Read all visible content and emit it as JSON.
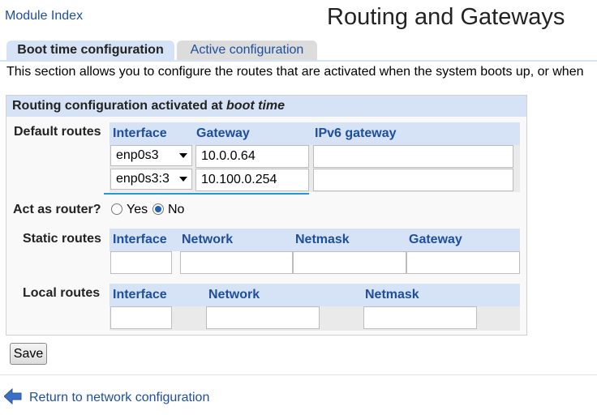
{
  "header": {
    "module_index": "Module Index",
    "title": "Routing and Gateways"
  },
  "tabs": [
    {
      "label": "Boot time configuration",
      "active": true
    },
    {
      "label": "Active configuration",
      "active": false
    }
  ],
  "intro": "This section allows you to configure the routes that are activated when the system boots up, or when",
  "panel": {
    "title_prefix": "Routing configuration activated at ",
    "title_emphasis": "boot time",
    "default_routes": {
      "label": "Default routes",
      "columns": [
        "Interface",
        "Gateway",
        "IPv6 gateway"
      ],
      "rows": [
        {
          "interface": "enp0s3",
          "gateway": "10.0.0.64",
          "ipv6_gateway": ""
        },
        {
          "interface": "enp0s3:3",
          "gateway": "10.100.0.254",
          "ipv6_gateway": ""
        }
      ]
    },
    "act_as_router": {
      "label": "Act as router?",
      "options": [
        "Yes",
        "No"
      ],
      "selected": "No"
    },
    "static_routes": {
      "label": "Static routes",
      "columns": [
        "Interface",
        "Network",
        "Netmask",
        "Gateway"
      ],
      "row": {
        "interface": "",
        "network": "",
        "netmask": "",
        "gateway": ""
      }
    },
    "local_routes": {
      "label": "Local routes",
      "columns": [
        "Interface",
        "Network",
        "Netmask"
      ],
      "row": {
        "interface": "",
        "network": "",
        "netmask": ""
      }
    }
  },
  "save_label": "Save",
  "footer": {
    "return_link": "Return to network configuration",
    "icon": "left-arrow-icon"
  },
  "colors": {
    "accent_blue": "#1f4e9a",
    "header_bg": "#d6e3f6",
    "focus": "#1e9bd7"
  }
}
